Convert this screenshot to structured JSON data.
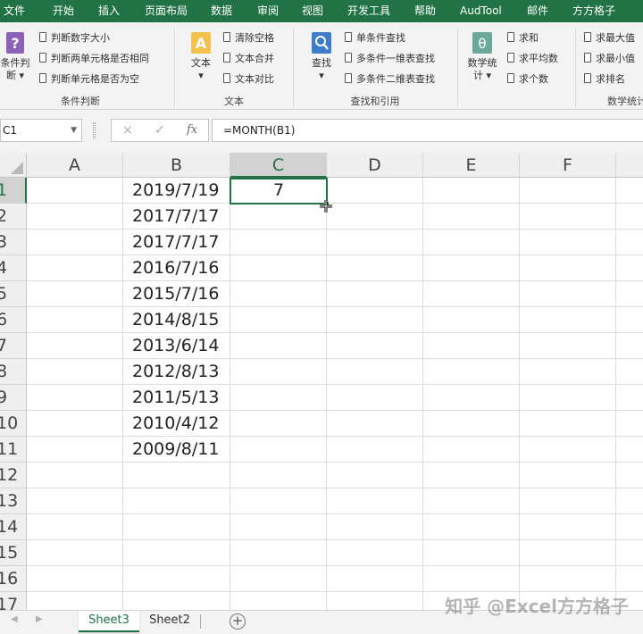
{
  "menu": {
    "tabs": [
      "文件",
      "开始",
      "插入",
      "页面布局",
      "数据",
      "审阅",
      "视图",
      "开发工具",
      "帮助",
      "AudTool",
      "邮件",
      "方方格子"
    ]
  },
  "ribbon": {
    "condition_group": {
      "big_button": "条件判断",
      "big_button_line1": "条件判",
      "big_button_line2": "断 ▾",
      "items": [
        "判断数字大小",
        "判断两单元格是否相同",
        "判断单元格是否为空"
      ],
      "label": "条件判断"
    },
    "text_group": {
      "big_button": "文本",
      "items": [
        "清除空格",
        "文本合并",
        "文本对比"
      ],
      "label": "文本"
    },
    "lookup_group": {
      "big_button": "查找",
      "items": [
        "单条件查找",
        "多条件一维表查找",
        "多条件二维表查找"
      ],
      "label": "查找和引用"
    },
    "math_group": {
      "big_button_line1": "数学统",
      "big_button_line2": "计 ▾",
      "items": [
        "求和",
        "求平均数",
        "求个数"
      ],
      "items2": [
        "求最大值",
        "求最小值",
        "求排名"
      ],
      "label": "数学统计"
    }
  },
  "formula_bar": {
    "name_box": "C1",
    "cancel_icon": "×",
    "enter_icon": "✓",
    "fx_icon": "fx",
    "formula": "=MONTH(B1)"
  },
  "grid": {
    "columns": [
      "A",
      "B",
      "C",
      "D",
      "E",
      "F"
    ],
    "rows": [
      "1",
      "2",
      "3",
      "4",
      "5",
      "6",
      "7",
      "8",
      "9",
      "10",
      "11",
      "12",
      "13",
      "14",
      "15",
      "16",
      "17"
    ],
    "column_b": [
      "2019/7/19",
      "2017/7/17",
      "2017/7/17",
      "2016/7/16",
      "2015/7/16",
      "2014/8/15",
      "2013/6/14",
      "2012/8/13",
      "2011/5/13",
      "2010/4/12",
      "2009/8/11"
    ],
    "c1": "7",
    "active_cell": "C1"
  },
  "sheets": {
    "tabs": [
      "Sheet3",
      "Sheet2"
    ],
    "active": "Sheet3",
    "add_icon": "+"
  },
  "watermark": "知乎 @Excel方方格子",
  "colors": {
    "accent": "#217346",
    "ribbon_bg": "#f3f3f3"
  }
}
